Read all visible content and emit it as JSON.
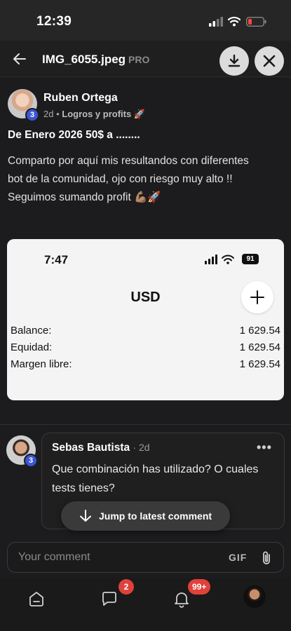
{
  "status_bar": {
    "time": "12:39"
  },
  "header": {
    "filename": "IMG_6055.jpeg",
    "badge": "PRO",
    "download_icon": "download-icon",
    "close_icon": "close-icon"
  },
  "post": {
    "author": "Ruben Ortega",
    "level": "3",
    "age": "2d",
    "category": "Logros y profits 🚀",
    "title": "De Enero 2026 50$ a ........",
    "body_lines": [
      "Comparto por aquí mis resultandos con diferentes",
      "bot de la comunidad, ojo con riesgo muy alto !!",
      "Seguimos sumando profit 💪🏽🚀"
    ]
  },
  "embedded": {
    "time": "7:47",
    "battery": "91",
    "currency": "USD",
    "rows": [
      {
        "label": "Balance:",
        "value": "1 629.54"
      },
      {
        "label": "Equidad:",
        "value": "1 629.54"
      },
      {
        "label": "Margen libre:",
        "value": "1 629.54"
      }
    ]
  },
  "comment": {
    "author": "Sebas Bautista",
    "age": "· 2d",
    "level": "3",
    "text_lines": [
      "Que combinación has utilizado? O cuales",
      "tests tienes?"
    ],
    "more": "•••"
  },
  "jump_button": "Jump to latest comment",
  "composer": {
    "placeholder": "Your comment",
    "gif": "GIF"
  },
  "tabbar": {
    "chat_count": "2",
    "notifications_count": "99+"
  },
  "colors": {
    "background": "#1c1c1e",
    "level_badge": "#3b56d6",
    "notification_badge": "#e0413b"
  }
}
